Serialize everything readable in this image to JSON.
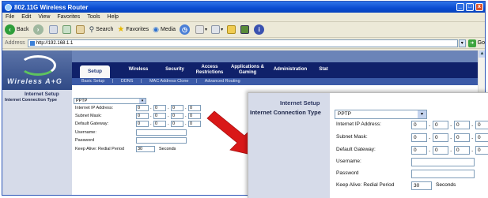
{
  "window": {
    "title": "802.11G Wireless Router",
    "buttons": {
      "minimize": "_",
      "maximize": "□",
      "close": "x"
    }
  },
  "menu": [
    "File",
    "Edit",
    "View",
    "Favorites",
    "Tools",
    "Help"
  ],
  "toolbar": {
    "back": "Back",
    "search": "Search",
    "favorites": "Favorites",
    "media": "Media"
  },
  "address": {
    "label": "Address",
    "url": "http://192.168.1.1",
    "go": "Go"
  },
  "router": {
    "logo_text": "Wireless A+G",
    "tabs": [
      "Setup",
      "Wireless",
      "Security",
      "Access Restrictions",
      "Applications & Gaming",
      "Administration",
      "Stat"
    ],
    "subnav": [
      "Basic Setup",
      "|",
      "DDNS",
      "|",
      "MAC Address Clone",
      "|",
      "Advanced Routing"
    ],
    "section_title": "Internet Setup",
    "connection_label": "Internet Connection Type",
    "connection_value": "PPTP",
    "fields": {
      "ip": "Internet IP Address:",
      "mask": "Subnet Mask:",
      "gateway": "Default Gateway:",
      "username": "Username:",
      "password": "Password",
      "keepalive": "Keep Alive: Redial Period"
    },
    "octet": "0",
    "dot": ".",
    "keepalive_value": "30",
    "seconds": "Seconds"
  },
  "colors": {
    "callout_arrow": "#d91818",
    "title_bar": "#0a4bd0",
    "router_nav": "#10216a",
    "sidebar": "#d6dbe9"
  }
}
